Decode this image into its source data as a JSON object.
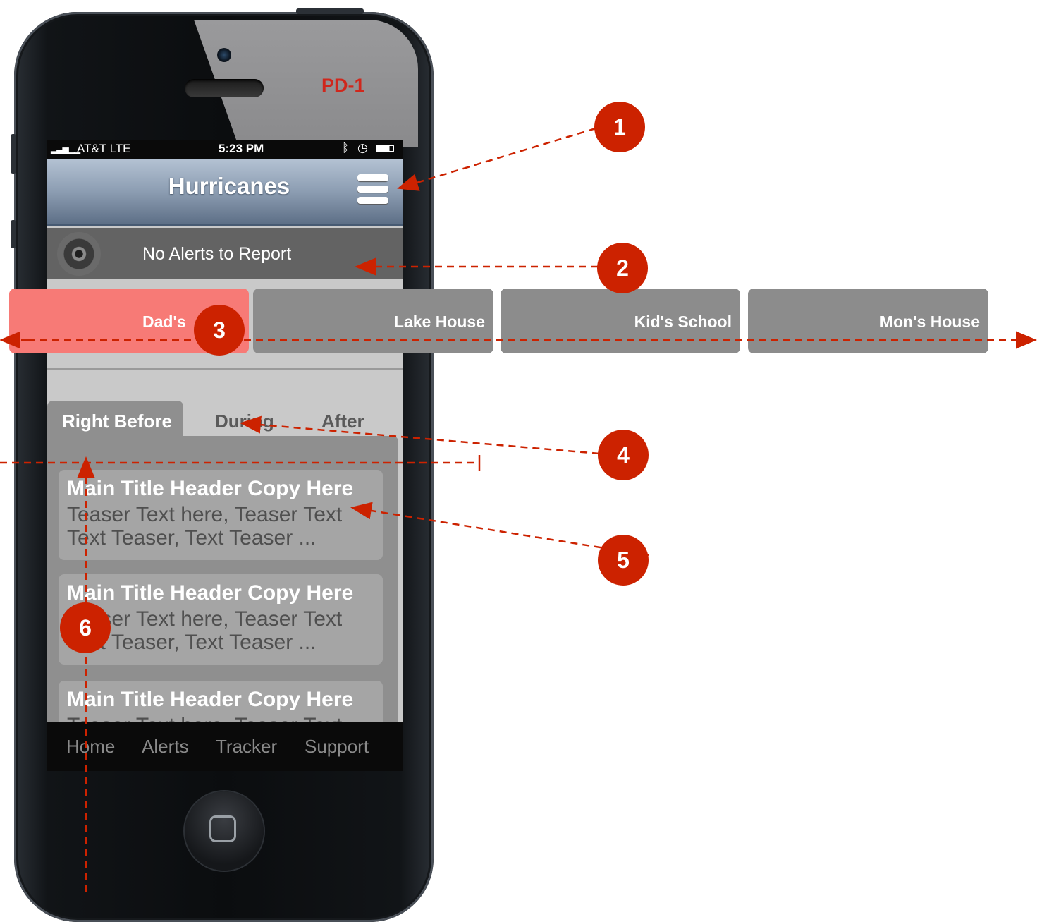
{
  "device_label": "PD-1",
  "status_bar": {
    "carrier": "AT&T LTE",
    "time": "5:23 PM"
  },
  "nav": {
    "title": "Hurricanes"
  },
  "alert": {
    "text": "No Alerts to Report"
  },
  "locations": [
    {
      "label": "Dad's"
    },
    {
      "label": "Lake House"
    },
    {
      "label": "Kid's School"
    },
    {
      "label": "Mon's House"
    }
  ],
  "tabs": [
    {
      "label": "Right Before",
      "active": true
    },
    {
      "label": "During"
    },
    {
      "label": "After"
    }
  ],
  "cards": [
    {
      "title": "Main Title Header Copy Here",
      "teaser": "Teaser Text here, Teaser Text Text Teaser, Text Teaser ..."
    },
    {
      "title": "Main Title Header Copy Here",
      "teaser": "Teaser Text here, Teaser Text Text Teaser, Text Teaser ..."
    },
    {
      "title": "Main Title Header Copy Here",
      "teaser": "Teaser Text here, Teaser Text"
    }
  ],
  "bottom_tabs": [
    {
      "label": "Home"
    },
    {
      "label": "Alerts"
    },
    {
      "label": "Tracker"
    },
    {
      "label": "Support"
    }
  ],
  "annotations": [
    "1",
    "2",
    "3",
    "4",
    "5",
    "6"
  ],
  "colors": {
    "annotation": "#cc2200",
    "active_location": "#f77a76",
    "nav_gradient_top": "#b4c2d3"
  }
}
